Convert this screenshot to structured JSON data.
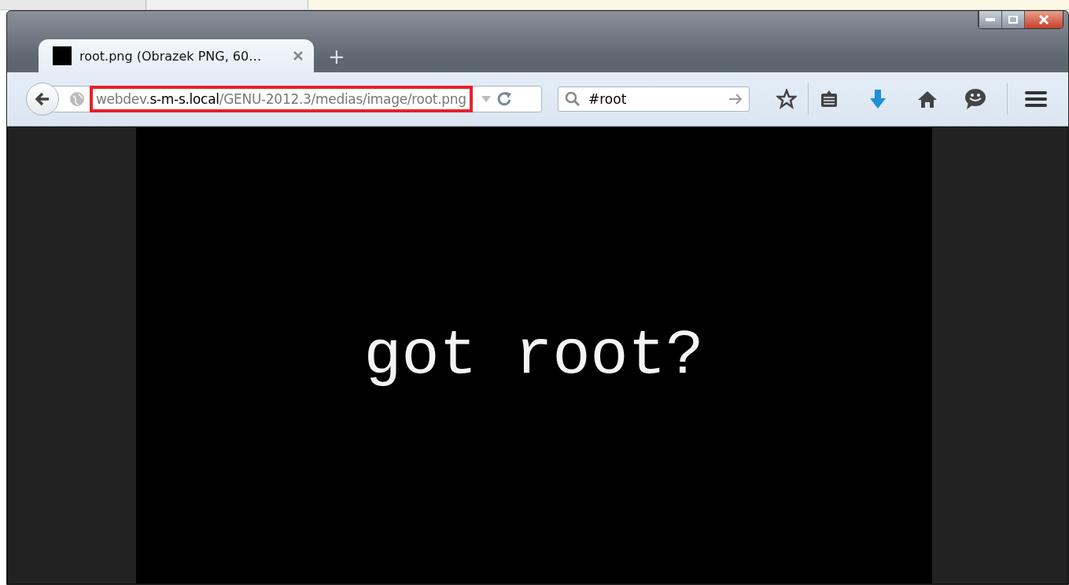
{
  "tabs": [
    {
      "title": "root.png (Obrazek PNG, 60…",
      "selected": true
    }
  ],
  "new_tab": {
    "label": "+"
  },
  "address_bar": {
    "url_prefix": "webdev.",
    "url_domain": "s-m-s.local",
    "url_path": "/GENU-2012.3/medias/image/root.png",
    "highlighted": true
  },
  "search": {
    "value": "#root"
  },
  "image": {
    "text": "got root?"
  }
}
